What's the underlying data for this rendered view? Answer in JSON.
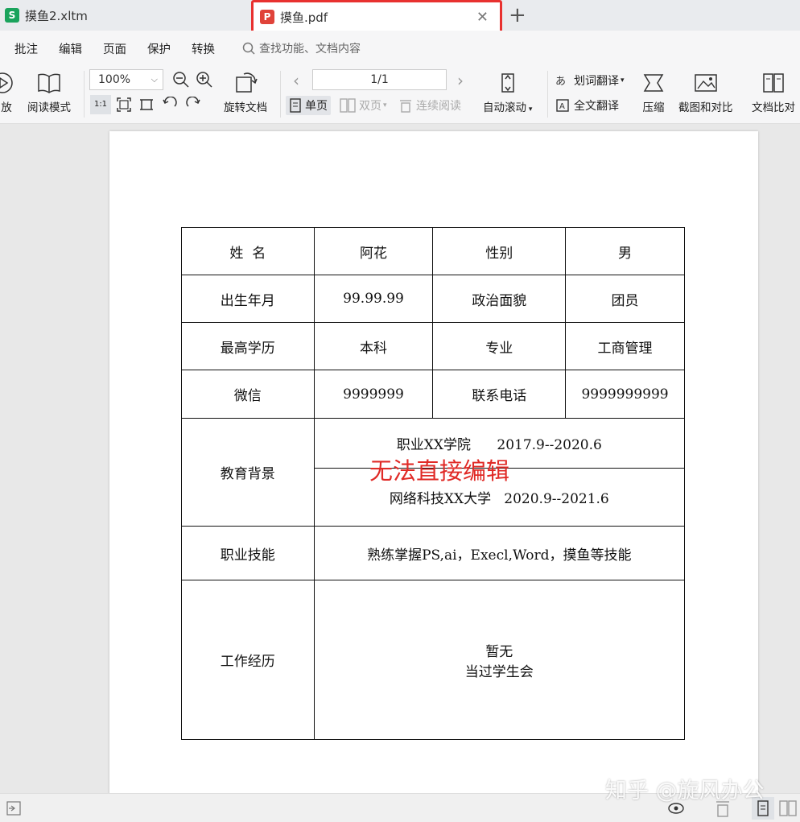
{
  "tabs": [
    {
      "label": "摸鱼2.xltm",
      "icon": "S"
    },
    {
      "label": "摸鱼.pdf",
      "icon": "P"
    }
  ],
  "menu": {
    "items": [
      "批注",
      "编辑",
      "页面",
      "保护",
      "转换"
    ],
    "search_placeholder": "查找功能、文档内容"
  },
  "toolbar": {
    "play_label": "放",
    "read_mode_label": "阅读模式",
    "zoom_value": "100%",
    "rotate_doc_label": "旋转文档",
    "page_indicator": "1/1",
    "single_page_label": "单页",
    "double_page_label": "双页",
    "continuous_label": "连续阅读",
    "auto_scroll_label": "自动滚动",
    "word_translate_label": "划词翻译",
    "full_translate_label": "全文翻译",
    "compress_label": "压缩",
    "screenshot_compare_label": "截图和对比",
    "doc_compare_label": "文档比对"
  },
  "form": {
    "name_label": "姓  名",
    "name_value": "阿花",
    "gender_label": "性别",
    "gender_value": "男",
    "birth_label": "出生年月",
    "birth_value": "99.99.99",
    "politics_label": "政治面貌",
    "politics_value": "团员",
    "education_label": "最高学历",
    "education_value": "本科",
    "major_label": "专业",
    "major_value": "工商管理",
    "wechat_label": "微信",
    "wechat_value": "9999999",
    "phone_label": "联系电话",
    "phone_value": "9999999999",
    "edu_bg_label": "教育背景",
    "edu_bg_1": "职业XX学院      2017.9--2020.6",
    "edu_bg_2": "网络科技XX大学   2020.9--2021.6",
    "skills_label": "职业技能",
    "skills_value": "熟练掌握PS,ai，Execl,Word，摸鱼等技能",
    "work_label": "工作经历",
    "work_line1": "暂无",
    "work_line2": "当过学生会"
  },
  "overlay_text": "无法直接编辑",
  "watermark": "知乎 @旋风办公",
  "colors": {
    "accent_red": "#e02a26",
    "tab_highlight": "#e8312f",
    "excel_green": "#1aa35c"
  }
}
